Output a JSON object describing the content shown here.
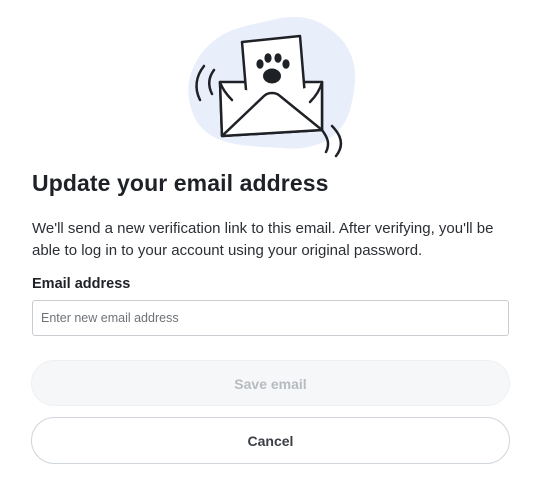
{
  "dialog": {
    "title": "Update your email address",
    "description": "We'll send a new verification link to this email. After verifying, you'll be able to log in to your account using your original password.",
    "illustration_icon": "envelope-with-paw-letter",
    "email_field": {
      "label": "Email address",
      "value": "",
      "placeholder": "Enter new email address"
    },
    "save_button": {
      "label": "Save email",
      "state": "disabled"
    },
    "cancel_button": {
      "label": "Cancel"
    }
  },
  "colors": {
    "illustration_blob": "#e9eefb",
    "text_primary": "#1e2126",
    "input_border": "#c9cdd2",
    "save_bg_disabled": "#f6f7f8",
    "save_text_disabled": "#b7bbc0",
    "cancel_border": "#cfd5da"
  }
}
